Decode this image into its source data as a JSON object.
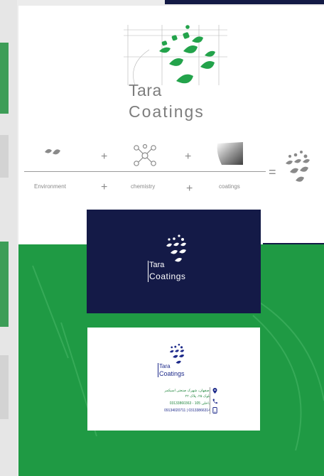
{
  "logo": {
    "line1": "Tara",
    "line2": "Coatings"
  },
  "formula": {
    "labels": [
      "Environment",
      "chemistry",
      "coatings"
    ],
    "plus": "+",
    "equals": "="
  },
  "card_front": {
    "line1": "Tara",
    "line2": "Coatings"
  },
  "card_back": {
    "line1": "Tara",
    "line2": "Coatings",
    "address_1": "اصفهان، شهرک صنعتی اسیکمر",
    "address_2": "بلوک ۲۵، پلاک ۲۲",
    "phone_1": "03133860363 - داخلی 105",
    "phone_2": "09134020711 | 03133866314"
  },
  "colors": {
    "brand_green": "#23a34b",
    "navy": "#141a47",
    "gray": "#7d7d7d"
  },
  "icons": [
    "leaf-icon",
    "molecule-icon",
    "texture-icon",
    "location-icon",
    "phone-icon",
    "mobile-icon"
  ]
}
